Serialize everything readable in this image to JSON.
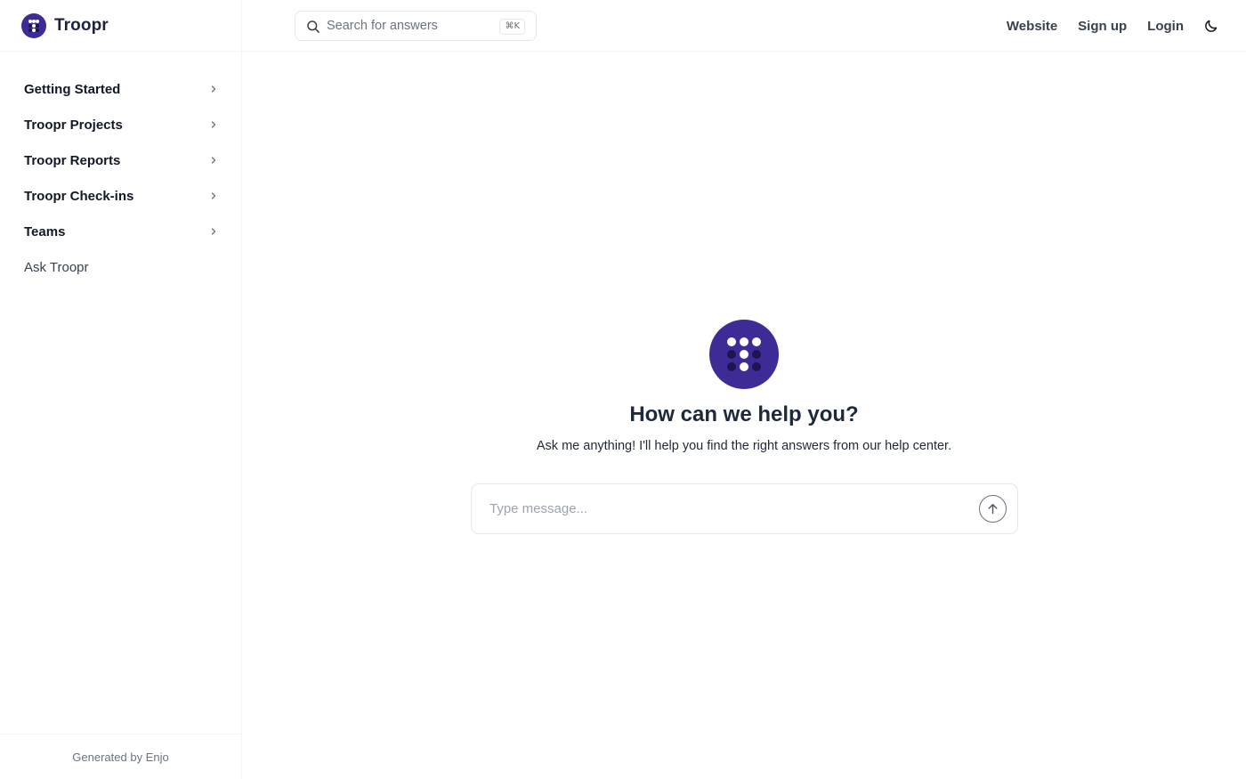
{
  "brand": {
    "name": "Troopr",
    "logo_icon": "troopr-dots-logo",
    "color": "#3f2b96"
  },
  "search": {
    "placeholder": "Search for answers",
    "shortcut": "⌘K",
    "icon": "search-icon"
  },
  "nav": {
    "website": "Website",
    "signup": "Sign up",
    "login": "Login",
    "theme_icon": "moon-icon"
  },
  "sidebar": {
    "items": [
      {
        "label": "Getting Started",
        "expandable": true
      },
      {
        "label": "Troopr Projects",
        "expandable": true
      },
      {
        "label": "Troopr Reports",
        "expandable": true
      },
      {
        "label": "Troopr Check-ins",
        "expandable": true
      },
      {
        "label": "Teams",
        "expandable": true
      },
      {
        "label": "Ask Troopr",
        "expandable": false
      }
    ],
    "footer": "Generated by Enjo"
  },
  "main": {
    "title": "How can we help you?",
    "subtitle": "Ask me anything! I'll help you find the right answers from our help center.",
    "chat": {
      "placeholder": "Type message...",
      "send_icon": "arrow-up-icon"
    }
  }
}
